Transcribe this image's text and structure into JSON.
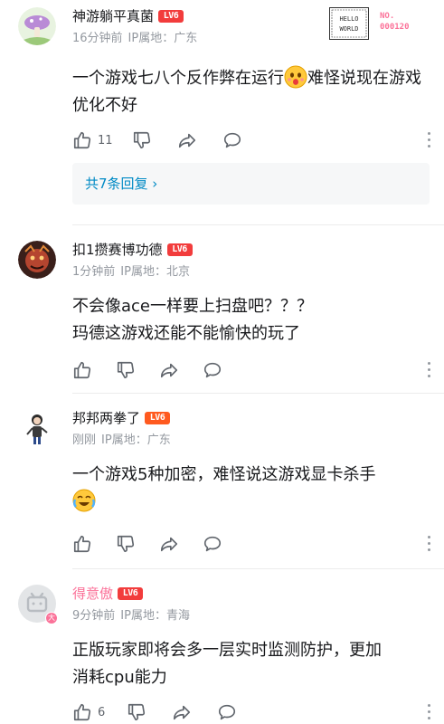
{
  "comments": [
    {
      "username": "神游躺平真菌",
      "level": "LV6",
      "time": "16分钟前",
      "ip_label": "IP属地：广东",
      "text_before_emoji": "一个游戏七八个反作弊在运行",
      "text_after_emoji": "难怪说现在游戏优化不好",
      "like_count": "11",
      "replies_label": "共7条回复 ›",
      "decoration": {
        "line1": "HELLO",
        "line2": "WORLD",
        "no_label": "NO.",
        "no_value": "000120"
      }
    },
    {
      "username": "扣1攒赛博功德",
      "level": "LV6",
      "time": "1分钟前",
      "ip_label": "IP属地：北京",
      "text_line1": "不会像ace一样要上扫盘吧？？？",
      "text_line2": "玛德这游戏还能不能愉快的玩了",
      "like_count": ""
    },
    {
      "username": "邦邦两拳了",
      "level": "LV6",
      "time": "刚刚",
      "ip_label": "IP属地：广东",
      "text": "一个游戏5种加密，难怪说这游戏显卡杀手",
      "like_count": ""
    },
    {
      "username": "得意傲",
      "level": "LV6",
      "time": "9分钟前",
      "ip_label": "IP属地：青海",
      "text_line1": "正版玩家即将会多一层实时监测防护，更加",
      "text_line2": "消耗cpu能力",
      "like_count": "6"
    }
  ],
  "colors": {
    "accent_pink": "#fb7299",
    "level_red": "#f23c3c",
    "link_blue": "#008ac5",
    "meta_gray": "#9499a0"
  },
  "icons": [
    "thumb-up-icon",
    "thumb-down-icon",
    "share-icon",
    "comment-icon",
    "more-vertical-icon",
    "chevron-right-icon"
  ]
}
